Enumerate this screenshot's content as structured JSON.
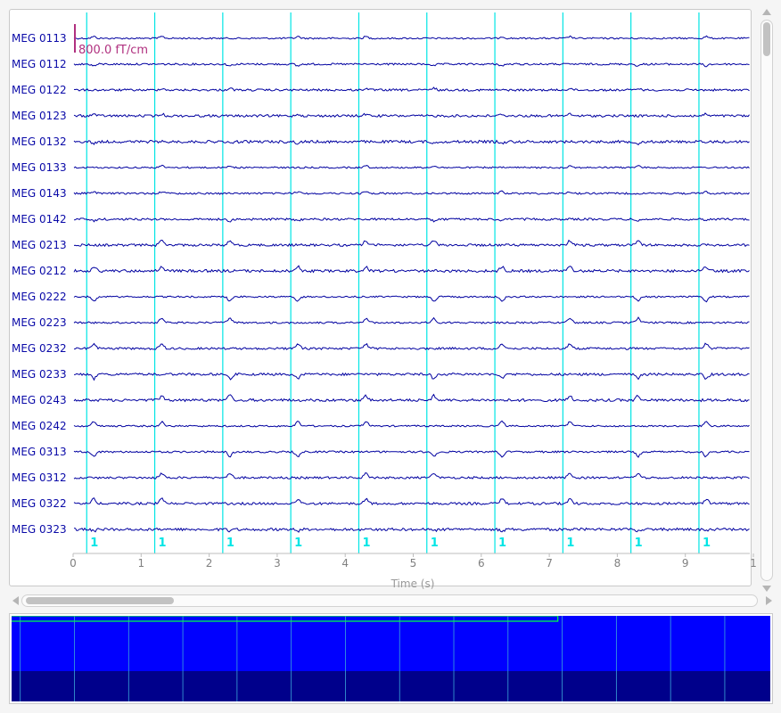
{
  "channels": [
    "MEG 0113",
    "MEG 0112",
    "MEG 0122",
    "MEG 0123",
    "MEG 0132",
    "MEG 0133",
    "MEG 0143",
    "MEG 0142",
    "MEG 0213",
    "MEG 0212",
    "MEG 0222",
    "MEG 0223",
    "MEG 0232",
    "MEG 0233",
    "MEG 0243",
    "MEG 0242",
    "MEG 0313",
    "MEG 0312",
    "MEG 0322",
    "MEG 0323"
  ],
  "scale_bar": {
    "label": "800.0 fT/cm"
  },
  "time_axis": {
    "title": "Time (s)",
    "ticks": [
      "0",
      "1",
      "2",
      "3",
      "4",
      "5",
      "6",
      "7",
      "8",
      "9",
      "1"
    ],
    "range": [
      0,
      10
    ]
  },
  "events": {
    "label": "1",
    "times": [
      0.2,
      1.2,
      2.2,
      3.2,
      4.2,
      5.2,
      6.2,
      7.2,
      8.2,
      9.2
    ]
  },
  "colors": {
    "trace": "#0000a0",
    "event": "#00e5e5",
    "scale": "#b0307f",
    "overview_top": "#0000ff",
    "overview_bottom": "#00008b",
    "overview_view": "#00ff44"
  },
  "overview": {
    "view_fraction": 0.72
  },
  "scrollbars": {
    "vertical_position": 0.0,
    "horizontal_position": 0.0
  }
}
